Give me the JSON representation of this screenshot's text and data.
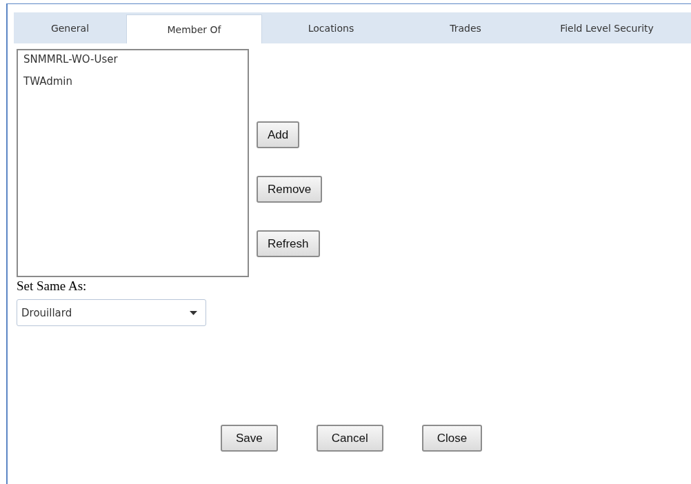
{
  "tabs": [
    {
      "label": "General",
      "selected": false
    },
    {
      "label": "Member Of",
      "selected": true
    },
    {
      "label": "Locations",
      "selected": false
    },
    {
      "label": "Trades",
      "selected": false
    },
    {
      "label": "Field Level Security",
      "selected": false
    }
  ],
  "member_list": {
    "items": [
      "SNMMRL-WO-User",
      "TWAdmin"
    ]
  },
  "list_buttons": [
    "Add",
    "Remove",
    "Refresh"
  ],
  "set_same_as": {
    "label": "Set Same As:",
    "value": "Drouillard"
  },
  "footer_buttons": [
    "Save",
    "Cancel",
    "Close"
  ]
}
